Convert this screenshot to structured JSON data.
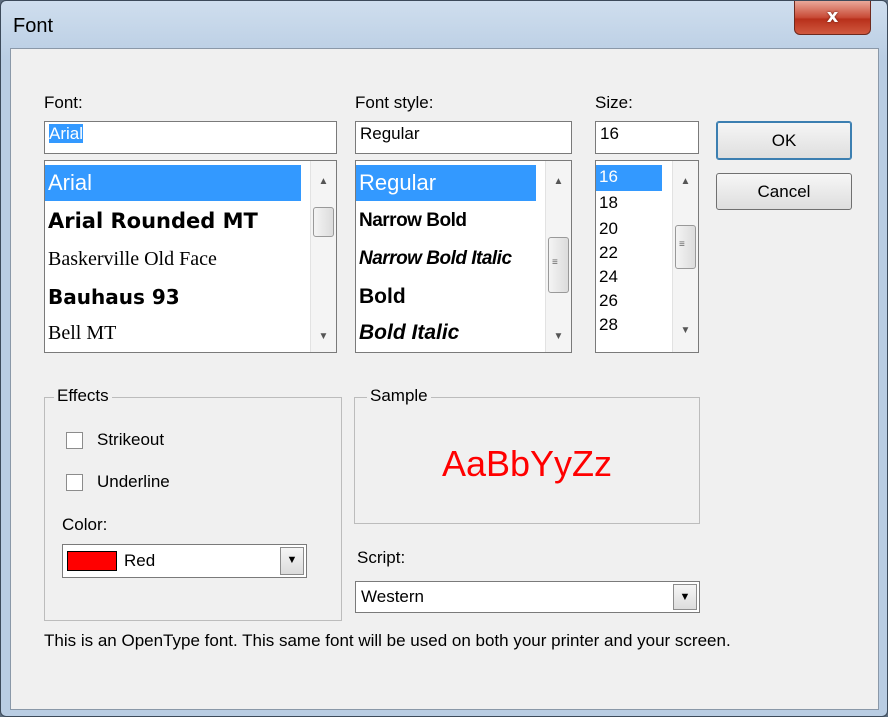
{
  "window": {
    "title": "Font",
    "close_glyph": "x"
  },
  "font": {
    "label": "Font:",
    "value": "Arial",
    "items": [
      "Arial",
      "Arial Rounded MT",
      "Baskerville Old Face",
      "Bauhaus 93",
      "Bell MT"
    ],
    "selected_index": 0
  },
  "font_style": {
    "label": "Font style:",
    "value": "Regular",
    "items": [
      "Regular",
      "Narrow Bold",
      "Narrow Bold Italic",
      "Bold",
      "Bold Italic"
    ],
    "selected_index": 0
  },
  "size": {
    "label": "Size:",
    "value": "16",
    "items": [
      "16",
      "18",
      "20",
      "22",
      "24",
      "26",
      "28"
    ],
    "selected_index": 0
  },
  "buttons": {
    "ok": "OK",
    "cancel": "Cancel"
  },
  "effects": {
    "title": "Effects",
    "strikeout_label": "Strikeout",
    "strikeout_checked": false,
    "underline_label": "Underline",
    "underline_checked": false,
    "color_label": "Color:",
    "color_value": "Red",
    "color_swatch": "#ff0000"
  },
  "sample": {
    "title": "Sample",
    "text": "AaBbYyZz",
    "color": "#ff0000"
  },
  "script": {
    "label": "Script:",
    "value": "Western"
  },
  "description": "This is an OpenType font. This same font will be used on both your printer and your screen."
}
